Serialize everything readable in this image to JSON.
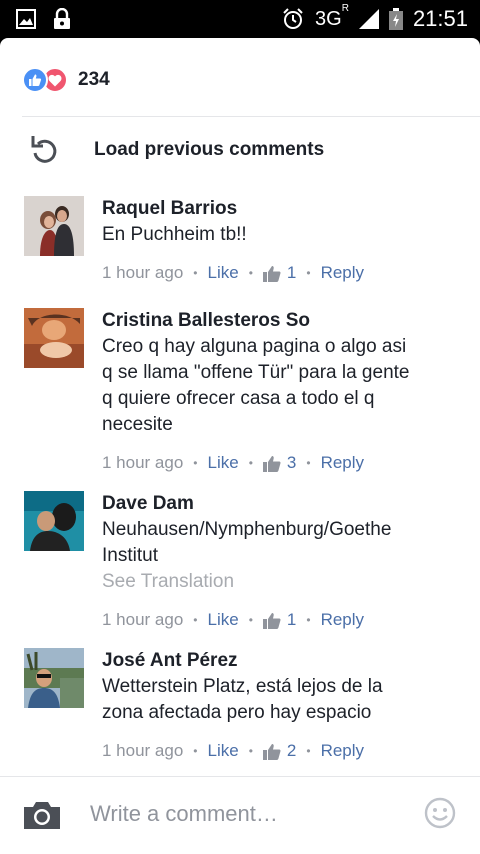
{
  "status_bar": {
    "network": "3G",
    "network_sup": "R",
    "time": "21:51"
  },
  "reactions": {
    "count": "234",
    "icons": [
      "like-icon",
      "love-icon"
    ]
  },
  "load_previous": "Load previous comments",
  "comments": [
    {
      "author": "Raquel Barrios",
      "lines": [
        "En Puchheim tb!!"
      ],
      "translation": "",
      "time": "1 hour ago",
      "like_label": "Like",
      "likes": "1",
      "reply_label": "Reply"
    },
    {
      "author": "Cristina Ballesteros So",
      "lines": [
        "Creo q hay alguna pagina o algo asi",
        "q se llama \"offene Tür\" para la gente",
        "q quiere ofrecer casa a todo el q",
        "necesite"
      ],
      "translation": "",
      "time": "1 hour ago",
      "like_label": "Like",
      "likes": "3",
      "reply_label": "Reply"
    },
    {
      "author": "Dave Dam",
      "lines": [
        "Neuhausen/Nymphenburg/Goethe",
        "Institut"
      ],
      "translation": "See Translation",
      "time": "1 hour ago",
      "like_label": "Like",
      "likes": "1",
      "reply_label": "Reply"
    },
    {
      "author": "José Ant Pérez",
      "lines": [
        "Wetterstein Platz, está lejos de la",
        "zona afectada pero hay espacio"
      ],
      "translation": "",
      "time": "1 hour ago",
      "like_label": "Like",
      "likes": "2",
      "reply_label": "Reply"
    }
  ],
  "composer": {
    "placeholder": "Write a comment…"
  },
  "colors": {
    "link": "#4b6fa8",
    "like": "#4a90f5",
    "love": "#f0566f"
  }
}
